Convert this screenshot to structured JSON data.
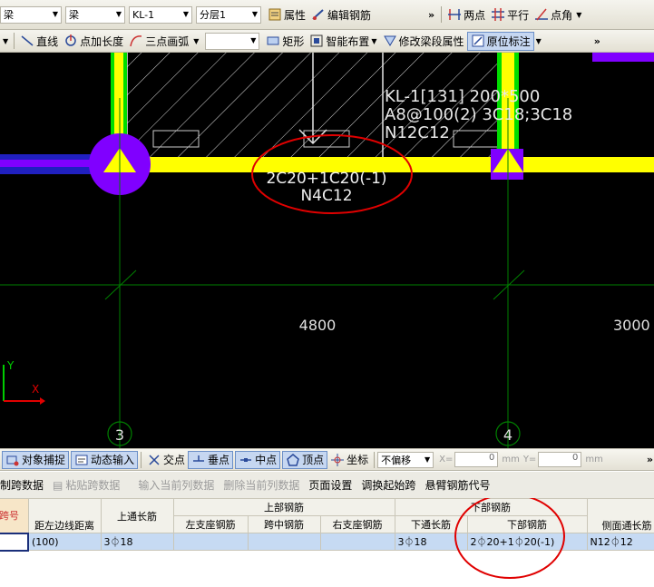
{
  "toolbar1": {
    "combo1": "梁",
    "combo2": "梁",
    "combo3": "KL-1",
    "combo4": "分层1",
    "attr": "属性",
    "edit_rebar": "编辑钢筋",
    "two_points": "两点",
    "parallel": "平行",
    "point_angle": "点角"
  },
  "toolbar2": {
    "line": "直线",
    "point_len": "点加长度",
    "arc3": "三点画弧",
    "combo_empty": "",
    "rect": "矩形",
    "smart_layout": "智能布置",
    "modify_span": "修改梁段属性",
    "inplace_mark": "原位标注"
  },
  "canvas": {
    "mark_line1": "KL-1[131] 200*500",
    "mark_line2": "A8@100(2) 3C18;3C18",
    "mark_line3": "N12C12",
    "annot_line1": "2C20+1C20(-1)",
    "annot_line2": "N4C12",
    "dim_span": "4800",
    "dim_right": "3000",
    "axis_3": "3",
    "axis_4": "4",
    "axis_y": "Y",
    "axis_x": "X",
    "colors": {
      "beam": "#ffff00",
      "column": "#00dd00",
      "circle": "#8000ff",
      "annotation": "#e00000",
      "grid": "#008000"
    }
  },
  "snapbar": {
    "obj_snap": "对象捕捉",
    "dyn_input": "动态输入",
    "intersect": "交点",
    "perp": "垂点",
    "mid": "中点",
    "vertex": "顶点",
    "coord": "坐标",
    "offset_mode": "不偏移",
    "x_label": "X=",
    "x_value": "0",
    "y_label": "Y=",
    "y_value": "0",
    "unit": "mm"
  },
  "datatoolbar": {
    "copy_span": "制跨数据",
    "paste_span": "粘贴跨数据",
    "input_col": "输入当前列数据",
    "delete_col": "删除当前列数据",
    "page_setup": "页面设置",
    "swap_start": "调换起始跨",
    "cantilever": "悬臂钢筋代号"
  },
  "table": {
    "h_span": "跨号",
    "h_dist": "距左边线距离",
    "h_top_through": "上通长筋",
    "h_top_group": "上部钢筋",
    "h_left_seat": "左支座钢筋",
    "h_mid_span": "跨中钢筋",
    "h_right_seat": "右支座钢筋",
    "h_bottom_group": "下部钢筋",
    "h_bottom_through": "下通长筋",
    "h_bottom": "下部钢筋",
    "h_side": "侧面通长筋",
    "row": {
      "span": "",
      "dist": "(100)",
      "top_through": "3⏀18",
      "left_seat": "",
      "mid_span": "",
      "right_seat": "",
      "bottom_through": "3⏀18",
      "bottom": "2⏀20+1⏀20(-1)",
      "side": "N12⏀12"
    }
  }
}
